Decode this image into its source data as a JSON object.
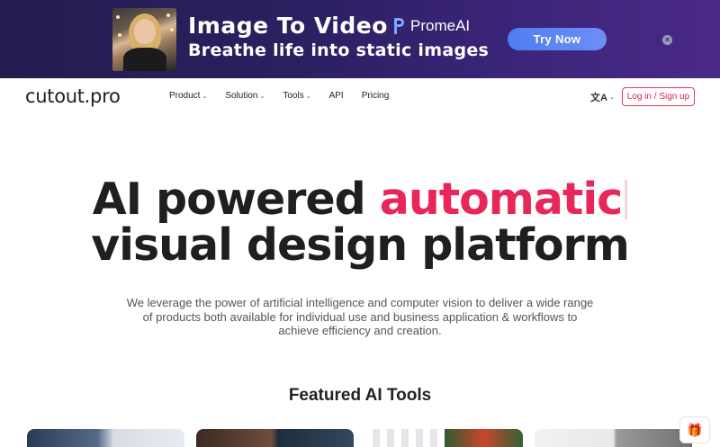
{
  "banner": {
    "title": "Image To Video",
    "subtitle": "Breathe life into static images",
    "brand_name": "PromeAI",
    "cta_label": "Try Now",
    "close_glyph": "×",
    "photo_icon": "portrait-photo",
    "colors": {
      "cta": "#5b86f4",
      "background": "#2b1f60"
    }
  },
  "nav": {
    "logo": "cutout.pro",
    "items": [
      {
        "label": "Product",
        "has_dropdown": true
      },
      {
        "label": "Solution",
        "has_dropdown": true
      },
      {
        "label": "Tools",
        "has_dropdown": true
      },
      {
        "label": "API",
        "has_dropdown": false
      },
      {
        "label": "Pricing",
        "has_dropdown": false
      }
    ],
    "caret_glyph": "⌄",
    "language_glyph": "文A",
    "login_label": "Log in / Sign up",
    "colors": {
      "login": "#d8284f"
    }
  },
  "hero": {
    "title_part1": "AI powered ",
    "title_accent": "automatic",
    "title_part2": "visual design platform",
    "description": "We leverage the power of artificial intelligence and computer vision to deliver a wide range of products both available for individual use and business application & workflows to achieve efficiency and creation.",
    "colors": {
      "accent": "#e8265a"
    }
  },
  "featured": {
    "heading": "Featured AI Tools"
  },
  "floating": {
    "gift_icon": "🎁"
  }
}
